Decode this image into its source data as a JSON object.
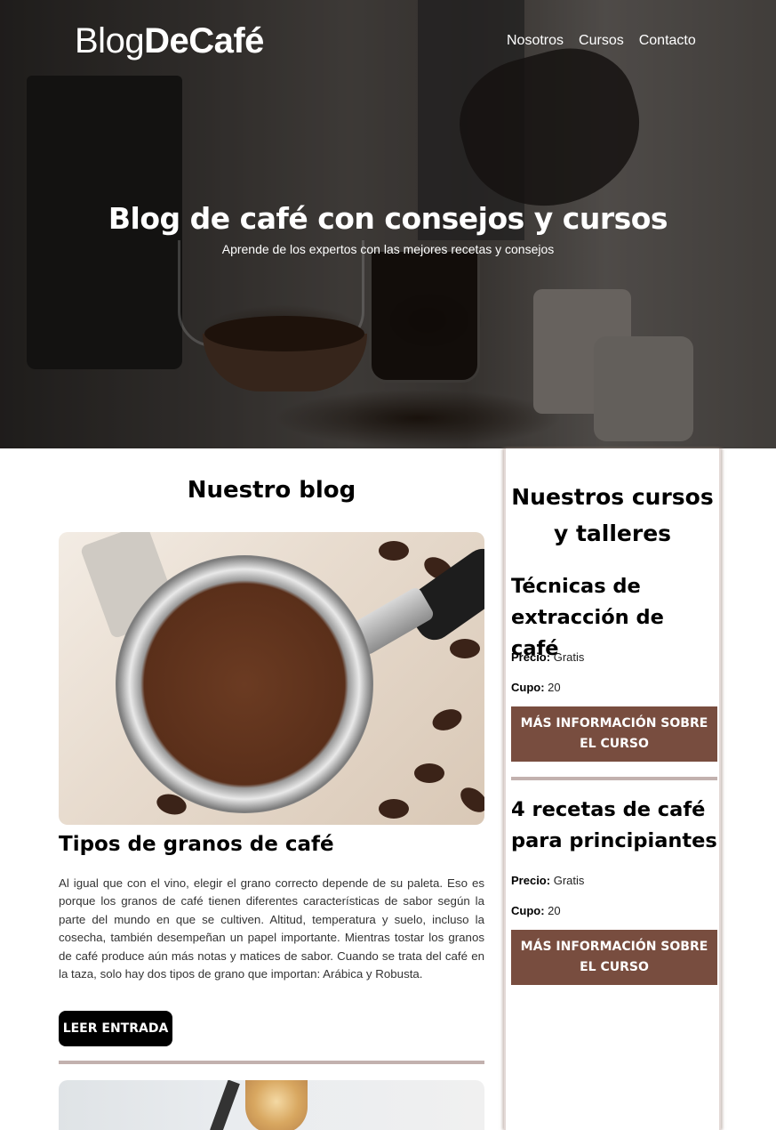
{
  "header": {
    "logo_light": "Blog",
    "logo_bold": "DeCafé",
    "nav": [
      "Nosotros",
      "Cursos",
      "Contacto"
    ]
  },
  "hero": {
    "title": "Blog de café con consejos y cursos",
    "subtitle": "Aprende de los expertos con las mejores recetas y consejos"
  },
  "blog": {
    "heading": "Nuestro blog",
    "posts": [
      {
        "title": "Tipos de granos de café",
        "excerpt": "Al igual que con el vino, elegir el grano correcto depende de su paleta. Eso es porque los granos de café tienen diferentes características de sabor según la parte del mundo en que se cultiven. Altitud, temperatura y suelo, incluso la cosecha, también desempeñan un papel importante. Mientras tostar los granos de café produce aún más notas y matices de sabor. Cuando se trata del café en la taza, solo hay dos tipos de grano que importan: Arábica y Robusta.",
        "button": "LEER ENTRADA"
      }
    ]
  },
  "sidebar": {
    "heading": "Nuestros cursos y talleres",
    "courses": [
      {
        "title": "Técnicas de extracción de café",
        "price_label": "Precio:",
        "price": "Gratis",
        "quota_label": "Cupo:",
        "quota": "20",
        "button": "MÁS INFORMACIÓN SOBRE EL CURSO"
      },
      {
        "title": "4 recetas de café para principiantes",
        "price_label": "Precio:",
        "price": "Gratis",
        "quota_label": "Cupo:",
        "quota": "20",
        "button": "MÁS INFORMACIÓN SOBRE EL CURSO"
      }
    ]
  },
  "colors": {
    "accent_brown": "#784d3f",
    "divider": "#c2b1ae",
    "button_dark": "#000000"
  }
}
